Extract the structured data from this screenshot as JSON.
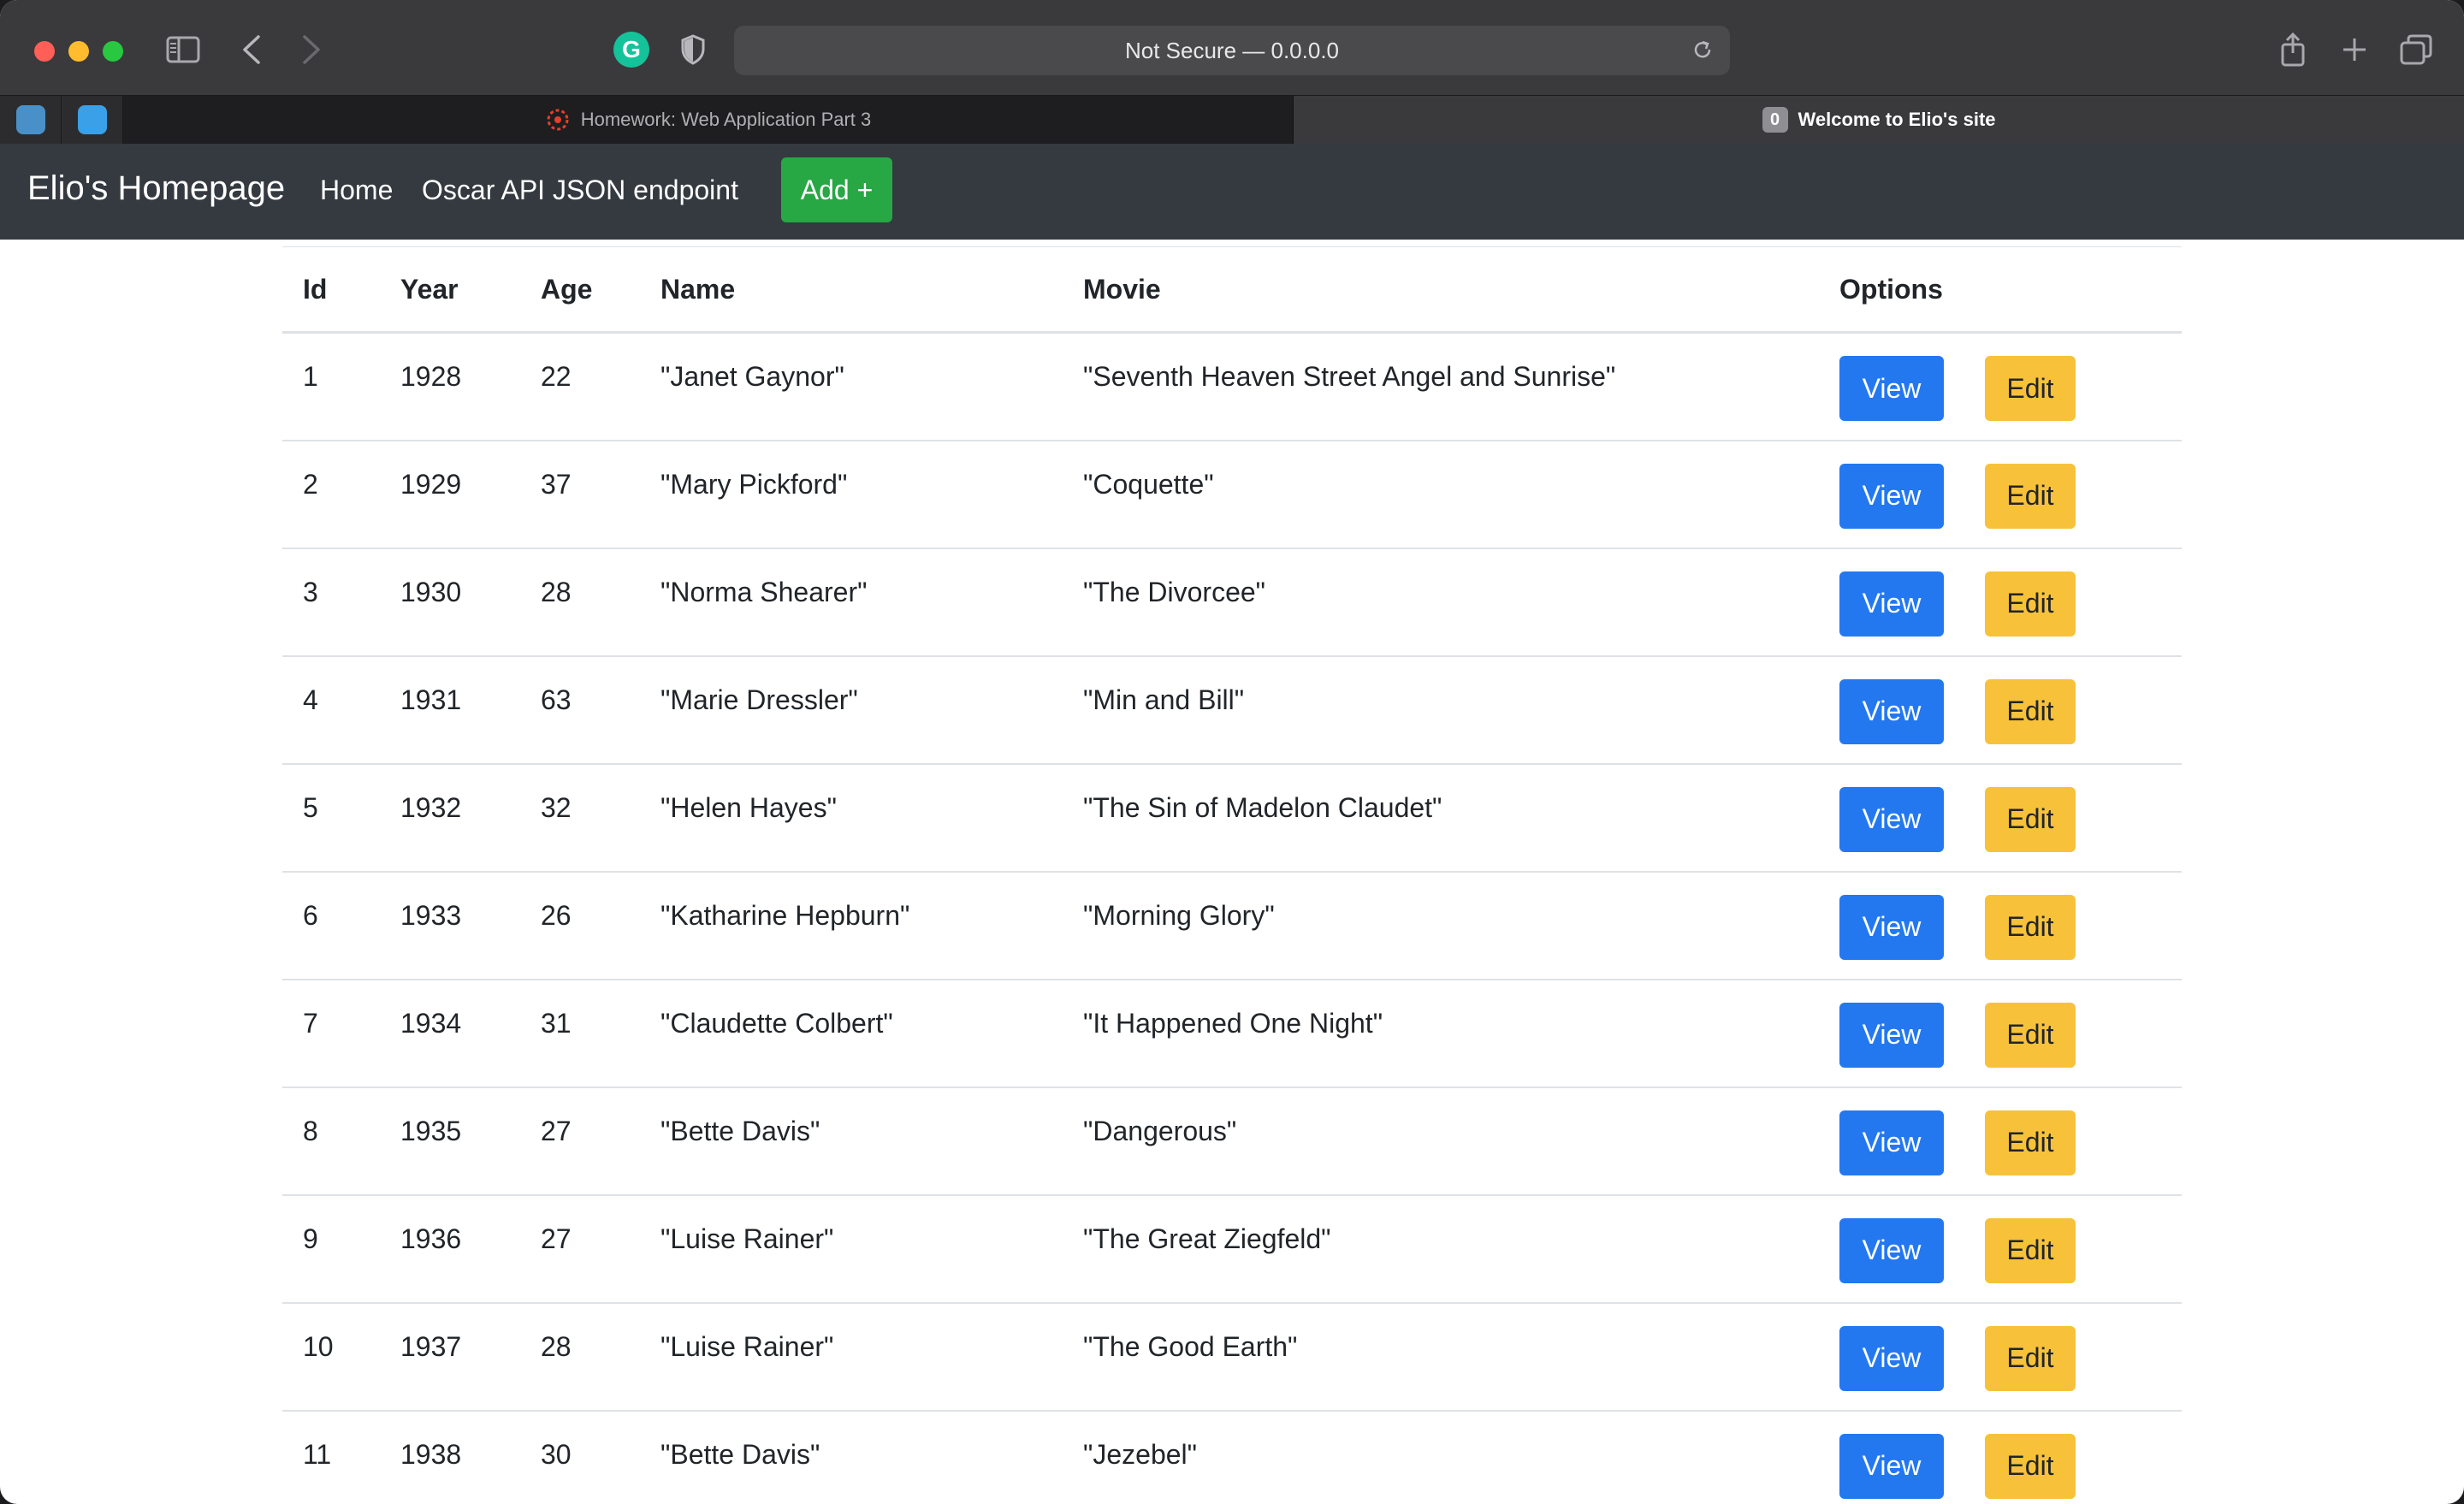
{
  "browser": {
    "address": "Not Secure — 0.0.0.0",
    "tabs": [
      {
        "label": "Homework: Web Application Part 3",
        "active": false
      },
      {
        "label": "Welcome to Elio's site",
        "active": true,
        "badge": "0"
      }
    ]
  },
  "navbar": {
    "brand": "Elio's Homepage",
    "links": [
      "Home",
      "Oscar API JSON endpoint"
    ],
    "add_label": "Add +"
  },
  "table": {
    "headers": [
      "Id",
      "Year",
      "Age",
      "Name",
      "Movie",
      "Options"
    ],
    "view_label": "View",
    "edit_label": "Edit",
    "rows": [
      [
        "1",
        "1928",
        "22",
        "\"Janet Gaynor\"",
        "\"Seventh Heaven Street Angel and Sunrise\""
      ],
      [
        "2",
        "1929",
        "37",
        "\"Mary Pickford\"",
        "\"Coquette\""
      ],
      [
        "3",
        "1930",
        "28",
        "\"Norma Shearer\"",
        "\"The Divorcee\""
      ],
      [
        "4",
        "1931",
        "63",
        "\"Marie Dressler\"",
        "\"Min and Bill\""
      ],
      [
        "5",
        "1932",
        "32",
        "\"Helen Hayes\"",
        "\"The Sin of Madelon Claudet\""
      ],
      [
        "6",
        "1933",
        "26",
        "\"Katharine Hepburn\"",
        "\"Morning Glory\""
      ],
      [
        "7",
        "1934",
        "31",
        "\"Claudette Colbert\"",
        "\"It Happened One Night\""
      ],
      [
        "8",
        "1935",
        "27",
        "\"Bette Davis\"",
        "\"Dangerous\""
      ],
      [
        "9",
        "1936",
        "27",
        "\"Luise Rainer\"",
        "\"The Great Ziegfeld\""
      ],
      [
        "10",
        "1937",
        "28",
        "\"Luise Rainer\"",
        "\"The Good Earth\""
      ],
      [
        "11",
        "1938",
        "30",
        "\"Bette Davis\"",
        "\"Jezebel\""
      ]
    ]
  },
  "colors": {
    "navbar_bg": "#343a40",
    "add_button": "#28a745",
    "view_button": "#2378f0",
    "edit_button": "#f7c23a"
  },
  "icons": [
    "sidebar-icon",
    "chevron-left-icon",
    "chevron-right-icon",
    "grammarly-icon",
    "privacy-shield-icon",
    "reload-icon",
    "share-icon",
    "plus-icon",
    "tab-overview-icon"
  ]
}
